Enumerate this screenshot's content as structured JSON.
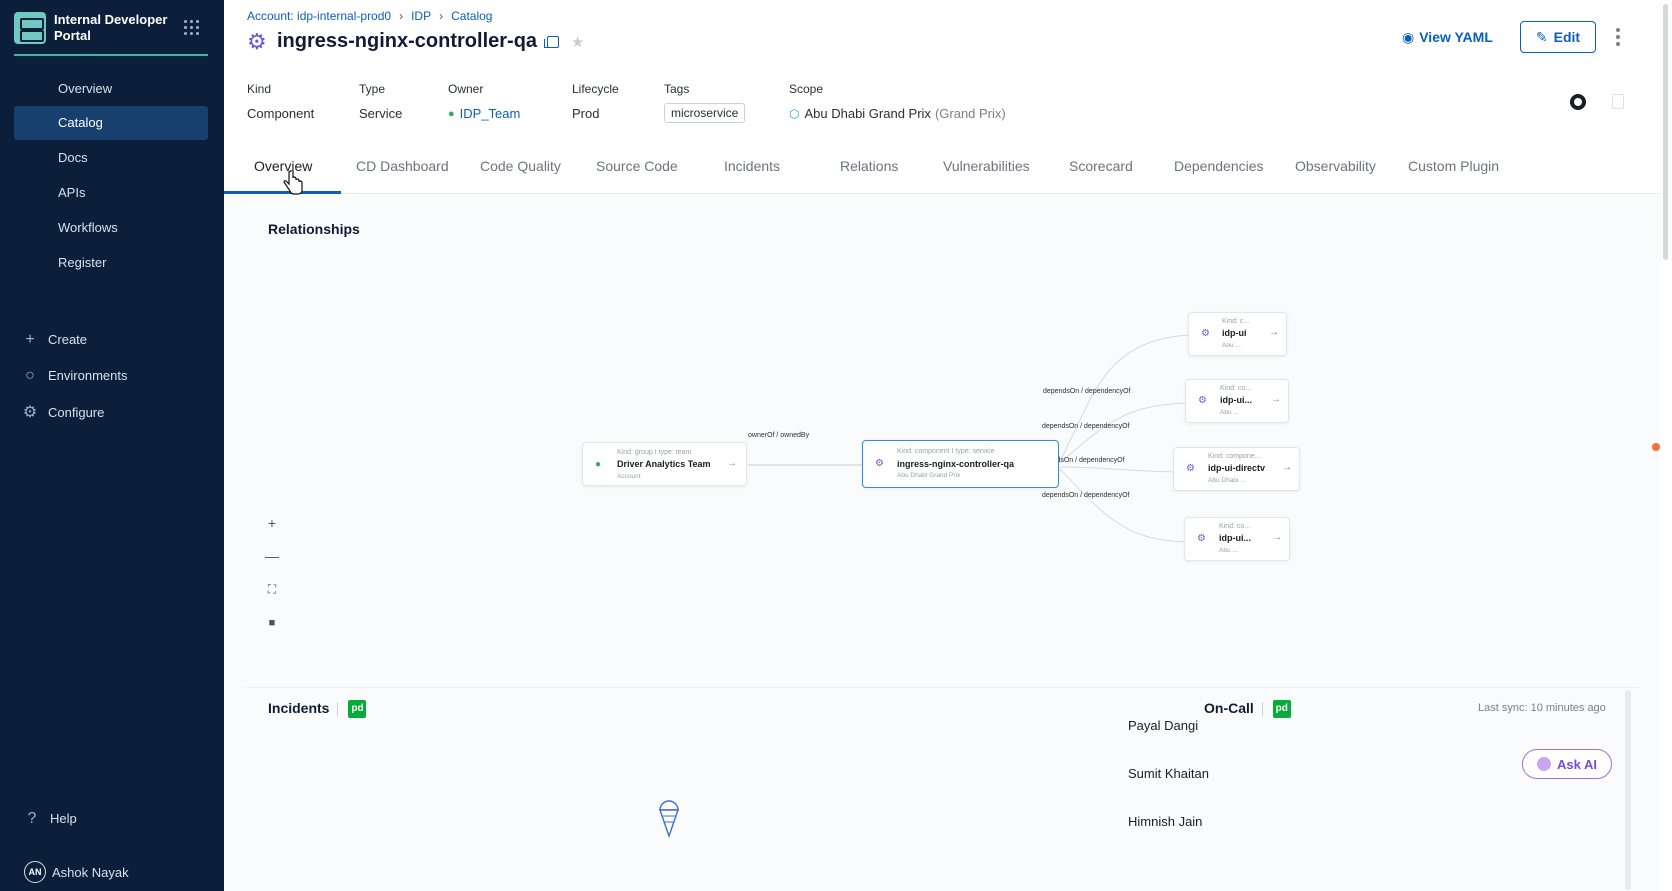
{
  "sidebar": {
    "brand": "Internal Developer Portal",
    "items": [
      {
        "label": "Overview"
      },
      {
        "label": "Catalog"
      },
      {
        "label": "Docs"
      },
      {
        "label": "APIs"
      },
      {
        "label": "Workflows"
      },
      {
        "label": "Register"
      }
    ],
    "actions": [
      {
        "label": "Create",
        "icon": "plus-icon"
      },
      {
        "label": "Environments",
        "icon": "environments-icon"
      },
      {
        "label": "Configure",
        "icon": "gear-icon"
      }
    ],
    "help": "Help",
    "user": {
      "initials": "AN",
      "name": "Ashok Nayak"
    }
  },
  "breadcrumb": {
    "items": [
      "Account: idp-internal-prod0",
      "IDP",
      "Catalog"
    ]
  },
  "header": {
    "title": "ingress-nginx-controller-qa",
    "view_yaml": "View YAML",
    "edit": "Edit"
  },
  "meta": {
    "kind": {
      "label": "Kind",
      "value": "Component"
    },
    "type": {
      "label": "Type",
      "value": "Service"
    },
    "owner": {
      "label": "Owner",
      "value": "IDP_Team"
    },
    "lifecycle": {
      "label": "Lifecycle",
      "value": "Prod"
    },
    "tags": {
      "label": "Tags",
      "value": "microservice"
    },
    "scope": {
      "label": "Scope",
      "value": "Abu Dhabi Grand Prix",
      "qualifier": "(Grand Prix)"
    }
  },
  "tabs": [
    "Overview",
    "CD Dashboard",
    "Code Quality",
    "Source Code",
    "Incidents",
    "Relations",
    "Vulnerabilities",
    "Scorecard",
    "Dependencies",
    "Observability",
    "Custom Plugin"
  ],
  "relationships": {
    "title": "Relationships",
    "team_node": {
      "kind": "Kind: group I type: team",
      "name": "Driver Analytics Team",
      "sub": "Account"
    },
    "center_node": {
      "kind": "Kind: component I type: service",
      "name": "ingress-nginx-controller-qa",
      "sub": "Abu Dhabi Grand Prix"
    },
    "owner_edge": "ownerOf / ownedBy",
    "dep_nodes": [
      {
        "kind": "Kind: c...",
        "name": "idp-ui",
        "sub": "Abu ..."
      },
      {
        "kind": "Kind: co...",
        "name": "idp-ui...",
        "sub": "Abu ..."
      },
      {
        "kind": "Kind: compone...",
        "name": "idp-ui-directv",
        "sub": "Abu Dhabi ..."
      },
      {
        "kind": "Kind: co...",
        "name": "idp-ui...",
        "sub": "Abu ..."
      }
    ],
    "dep_edges": [
      "dependsOn / dependencyOf",
      "dependsOn / dependencyOf",
      "dependsOn / dependencyOf",
      "dependsOn / dependencyOf"
    ]
  },
  "incidents": {
    "title": "Incidents",
    "badge": "pd"
  },
  "oncall": {
    "title": "On-Call",
    "badge": "pd",
    "last_sync": "Last sync: 10 minutes ago",
    "people": [
      "Payal Dangi",
      "Sumit Khaitan",
      "Himnish Jain"
    ]
  },
  "ask_ai": "Ask AI",
  "colors": {
    "sidebar_bg": "#0b1f3a",
    "accent": "#0b5fbd",
    "active_nav": "#17406e",
    "brand_teal": "#3fb6a8",
    "pagerduty": "#06ac38"
  }
}
